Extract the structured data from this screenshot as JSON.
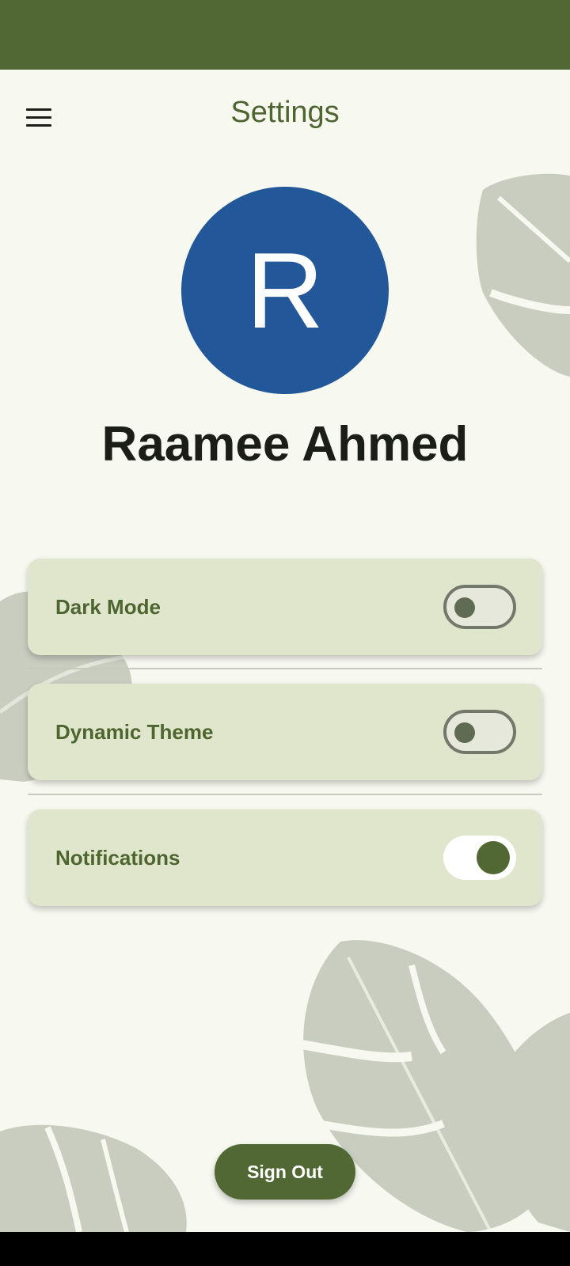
{
  "header": {
    "title": "Settings",
    "menu_icon": "hamburger-menu-icon"
  },
  "profile": {
    "avatar_letter": "R",
    "avatar_color": "#225799",
    "name": "Raamee Ahmed"
  },
  "settings": [
    {
      "label": "Dark Mode",
      "enabled": false
    },
    {
      "label": "Dynamic Theme",
      "enabled": false
    },
    {
      "label": "Notifications",
      "enabled": true
    }
  ],
  "actions": {
    "sign_out_label": "Sign Out"
  },
  "colors": {
    "primary": "#526834",
    "background": "#f7f8f0",
    "card": "#dfe6cc",
    "text_accent": "#4e6530"
  }
}
